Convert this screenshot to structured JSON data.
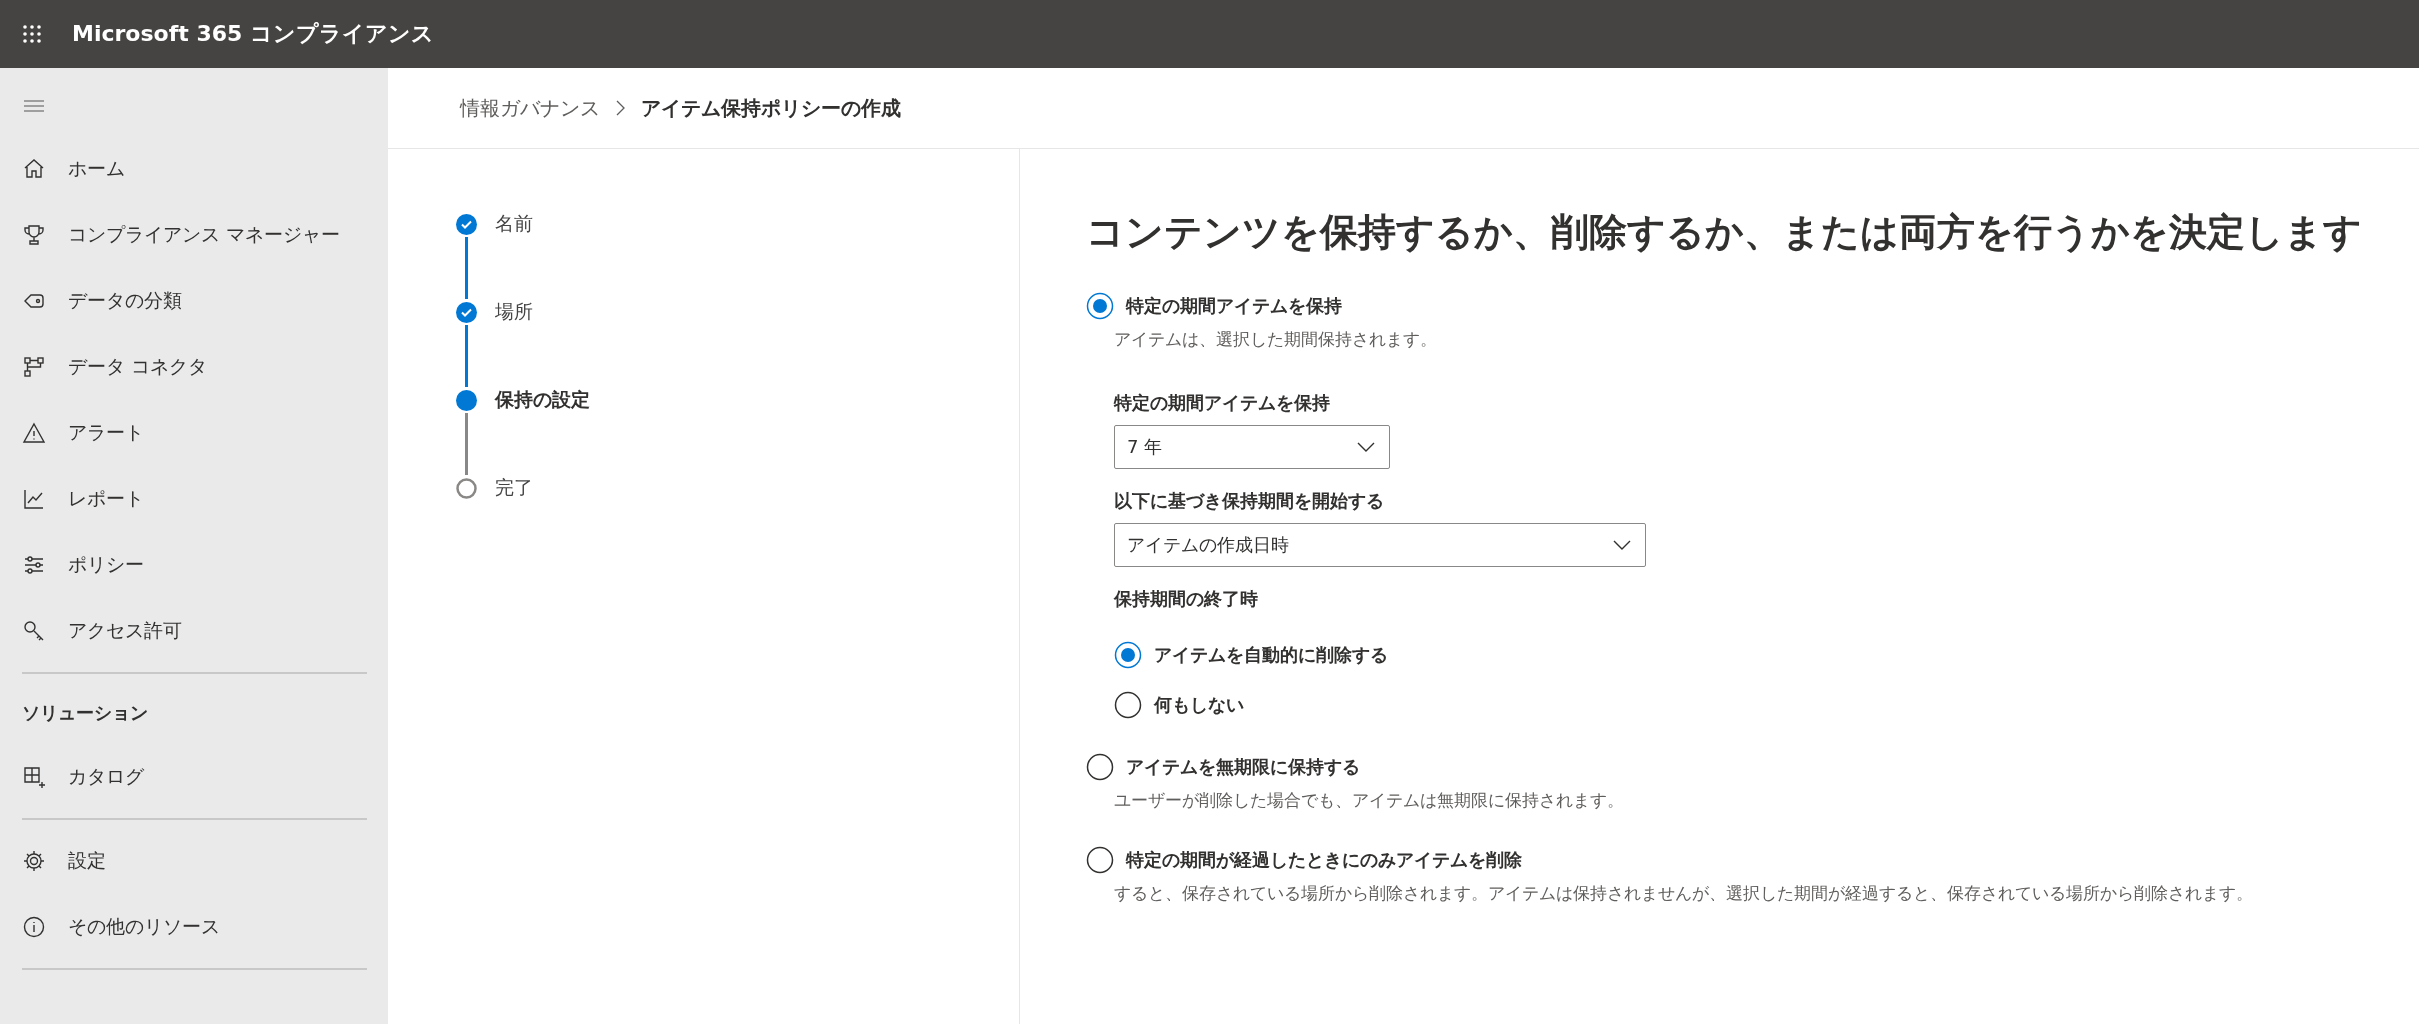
{
  "header": {
    "title": "Microsoft 365 コンプライアンス"
  },
  "sidebar": {
    "groups": [
      {
        "items": [
          {
            "kind": "home",
            "label": "ホーム"
          },
          {
            "kind": "trophy",
            "label": "コンプライアンス マネージャー"
          },
          {
            "kind": "tag",
            "label": "データの分類"
          },
          {
            "kind": "connector",
            "label": "データ コネクタ"
          },
          {
            "kind": "warning",
            "label": "アラート"
          },
          {
            "kind": "chart",
            "label": "レポート"
          },
          {
            "kind": "sliders",
            "label": "ポリシー"
          },
          {
            "kind": "key",
            "label": "アクセス許可"
          }
        ]
      },
      {
        "heading": "ソリューション",
        "items": [
          {
            "kind": "catalog",
            "label": "カタログ"
          }
        ]
      },
      {
        "items": [
          {
            "kind": "gear",
            "label": "設定"
          },
          {
            "kind": "info",
            "label": "その他のリソース"
          }
        ]
      }
    ]
  },
  "breadcrumb": {
    "parent": "情報ガバナンス",
    "current": "アイテム保持ポリシーの作成"
  },
  "steps": [
    {
      "label": "名前",
      "completed": true,
      "selected": false
    },
    {
      "label": "場所",
      "completed": true,
      "selected": false
    },
    {
      "label": "保持の設定",
      "completed": false,
      "selected": true
    },
    {
      "label": "完了",
      "completed": false,
      "selected": false
    }
  ],
  "page_title": "コンテンツを保持するか、削除するか、または両方を行うかを決定します",
  "options": [
    {
      "label": "特定の期間アイテムを保持",
      "selected": true,
      "description": "アイテムは、選択した期間保持されます。",
      "settings": {
        "period_label": "特定の期間アイテムを保持",
        "period_value": "7 年",
        "start_label": "以下に基づき保持期間を開始する",
        "start_value": "アイテムの作成日時",
        "end_label": "保持期間の終了時",
        "end_options": [
          {
            "label": "アイテムを自動的に削除する",
            "selected": true
          },
          {
            "label": "何もしない",
            "selected": false
          }
        ]
      }
    },
    {
      "label": "アイテムを無期限に保持する",
      "selected": false,
      "description": "ユーザーが削除した場合でも、アイテムは無期限に保持されます。"
    },
    {
      "label": "特定の期間が経過したときにのみアイテムを削除",
      "selected": false,
      "description": "すると、保存されている場所から削除されます。アイテムは保持されませんが、選択した期間が経過すると、保存されている場所から削除されます。"
    }
  ]
}
